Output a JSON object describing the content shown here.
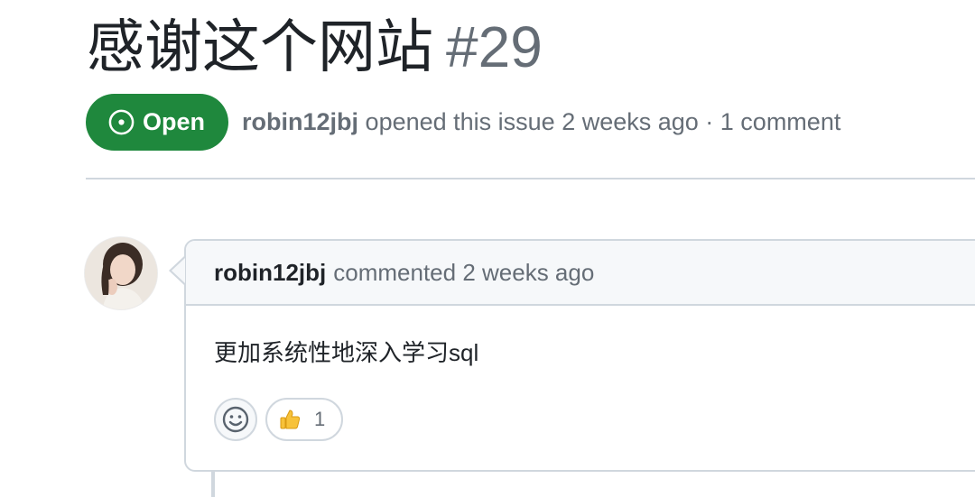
{
  "issue": {
    "title": "感谢这个网站",
    "number": "#29",
    "state": "Open",
    "author": "robin12jbj",
    "meta_suffix": "opened this issue 2 weeks ago · 1 comment"
  },
  "comment": {
    "author": "robin12jbj",
    "action": "commented 2 weeks ago",
    "body": "更加系统性地深入学习sql",
    "reactions": [
      {
        "icon": "thumbs-up-icon",
        "count": "1"
      }
    ]
  },
  "colors": {
    "open_green": "#1f883d",
    "muted_text": "#656d76",
    "border": "#d0d7de",
    "header_bg": "#f6f8fa"
  }
}
